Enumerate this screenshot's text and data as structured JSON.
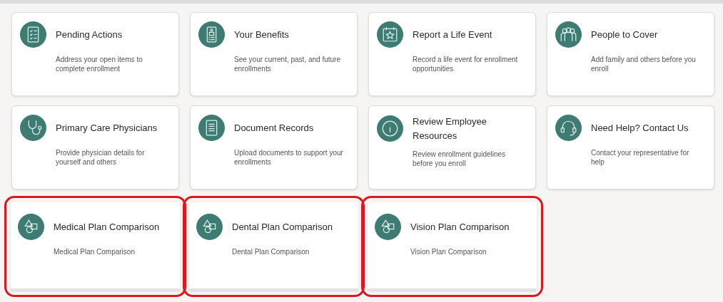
{
  "cards": [
    {
      "title": "Pending Actions",
      "description": "Address your open items to complete enrollment",
      "highlighted": false
    },
    {
      "title": "Your Benefits",
      "description": "See your current, past, and future enrollments",
      "highlighted": false
    },
    {
      "title": "Report a Life Event",
      "description": "Record a life event for enrollment opportunities",
      "highlighted": false
    },
    {
      "title": "People to Cover",
      "description": "Add family and others before you enroll",
      "highlighted": false
    },
    {
      "title": "Primary Care Physicians",
      "description": "Provide physician details for yourself and others",
      "highlighted": false
    },
    {
      "title": "Document Records",
      "description": "Upload documents to support your enrollments",
      "highlighted": false
    },
    {
      "title": "Review Employee Resources",
      "description": "Review enrollment guidelines before you enroll",
      "highlighted": false
    },
    {
      "title": "Need Help? Contact Us",
      "description": "Contact your representative for help",
      "highlighted": false
    },
    {
      "title": "Medical Plan Comparison",
      "description": "Medical Plan Comparison",
      "highlighted": true
    },
    {
      "title": "Dental Plan Comparison",
      "description": "Dental Plan Comparison",
      "highlighted": true
    },
    {
      "title": "Vision Plan Comparison",
      "description": "Vision Plan Comparison",
      "highlighted": true
    }
  ]
}
